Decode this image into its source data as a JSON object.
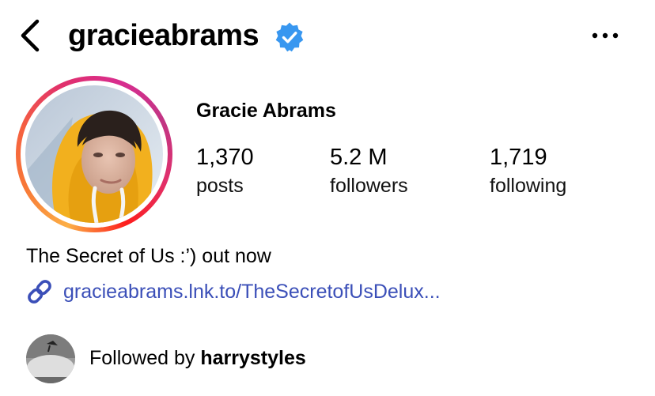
{
  "header": {
    "username": "gracieabrams",
    "back_icon": "chevron-left-icon",
    "verified_icon": "verified-badge-icon",
    "more_icon": "more-horizontal-icon",
    "verified_color": "#3897f0"
  },
  "profile": {
    "display_name": "Gracie Abrams",
    "story_ring_colors": [
      "#fcaf45",
      "#f56040",
      "#e1306c",
      "#c13584"
    ],
    "stats": {
      "posts": {
        "value": "1,370",
        "label": "posts"
      },
      "followers": {
        "value": "5.2 M",
        "label": "followers"
      },
      "following": {
        "value": "1,719",
        "label": "following"
      }
    },
    "bio": "The Secret of Us :’) out now",
    "link": {
      "icon": "link-icon",
      "text": "gracieabrams.lnk.to/TheSecretofUsDelux...",
      "color": "#3b4fb8"
    },
    "followed_by": {
      "prefix": "Followed by ",
      "username": "harrystyles"
    }
  }
}
